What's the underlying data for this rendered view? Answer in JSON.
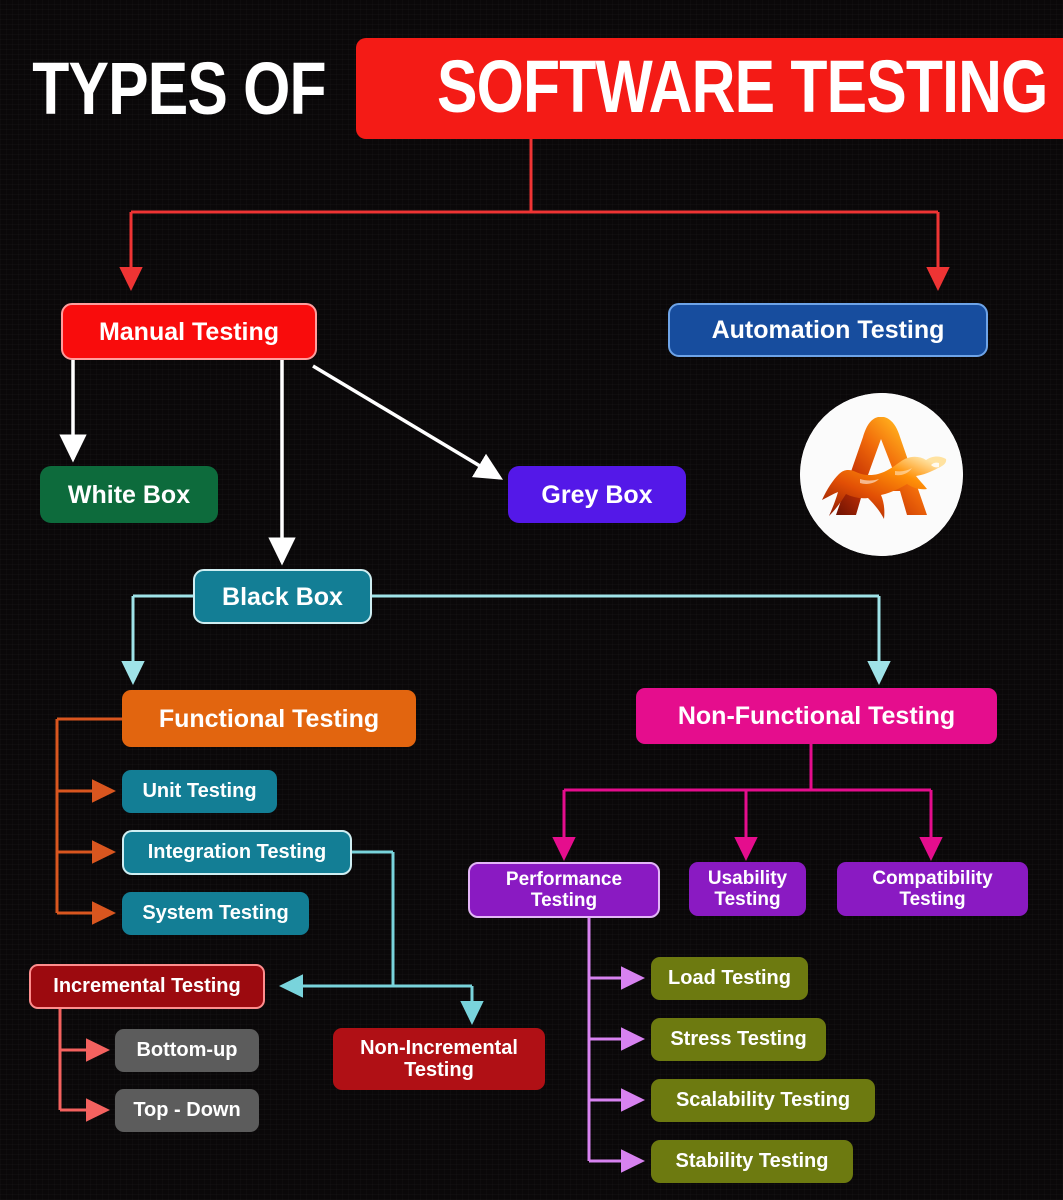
{
  "title": {
    "plain": "TYPES OF",
    "highlight": "SOFTWARE TESTING",
    "highlight_color": "#f41b16"
  },
  "logo": {
    "name": "flame-horse-a-logo",
    "letter": "A",
    "circle_color": "#fbfbfb",
    "flame_colors": [
      "#7a1405",
      "#c83205",
      "#f06a06",
      "#ffb400",
      "#ffe08a"
    ]
  },
  "nodes": {
    "manual": {
      "label": "Manual Testing",
      "fill": "#f90c0c",
      "border": "#ff9d9d"
    },
    "automation": {
      "label": "Automation Testing",
      "fill": "#174d9e",
      "border": "#6ea4e8"
    },
    "white_box": {
      "label": "White Box",
      "fill": "#0d6b3c",
      "border": "none"
    },
    "grey_box": {
      "label": "Grey Box",
      "fill": "#5418e8",
      "border": "none"
    },
    "black_box": {
      "label": "Black Box",
      "fill": "#137e95",
      "border": "#cfeef2"
    },
    "functional": {
      "label": "Functional Testing",
      "fill": "#e2650f",
      "border": "none"
    },
    "non_functional": {
      "label": "Non-Functional Testing",
      "fill": "#e50d8d",
      "border": "none"
    },
    "unit": {
      "label": "Unit Testing",
      "fill": "#137e95",
      "border": "none"
    },
    "integration": {
      "label": "Integration Testing",
      "fill": "#137e95",
      "border": "#cfeef2"
    },
    "system": {
      "label": "System Testing",
      "fill": "#137e95",
      "border": "none"
    },
    "incremental": {
      "label": "Incremental Testing",
      "fill": "#9c0a0f",
      "border": "#ff8d8d"
    },
    "bottom_up": {
      "label": "Bottom-up",
      "fill": "#5c5c5c",
      "border": "none"
    },
    "top_down": {
      "label": "Top - Down",
      "fill": "#5c5c5c",
      "border": "none"
    },
    "non_incremental": {
      "label": "Non-Incremental Testing",
      "fill": "#b01015",
      "border": "none"
    },
    "performance": {
      "label": "Performance Testing",
      "fill": "#8a1ac2",
      "border": "#e3b5f7"
    },
    "usability": {
      "label": "Usability Testing",
      "fill": "#8a1ac2",
      "border": "none"
    },
    "compatibility": {
      "label": "Compatibility Testing",
      "fill": "#8a1ac2",
      "border": "none"
    },
    "load": {
      "label": "Load Testing",
      "fill": "#6d7a10",
      "border": "none"
    },
    "stress": {
      "label": "Stress Testing",
      "fill": "#6d7a10",
      "border": "none"
    },
    "scalability": {
      "label": "Scalability Testing",
      "fill": "#6d7a10",
      "border": "none"
    },
    "stability": {
      "label": "Stability Testing",
      "fill": "#6d7a10",
      "border": "none"
    }
  },
  "connector_colors": {
    "root": "#ef3434",
    "manual": "#ffffff",
    "black_box": "#9fe3e8",
    "functional": "#d9561f",
    "integration": "#79d4dc",
    "incremental": "#f4625f",
    "non_functional": "#e50d8d",
    "performance": "#d782f0"
  },
  "background": "#0a0809"
}
